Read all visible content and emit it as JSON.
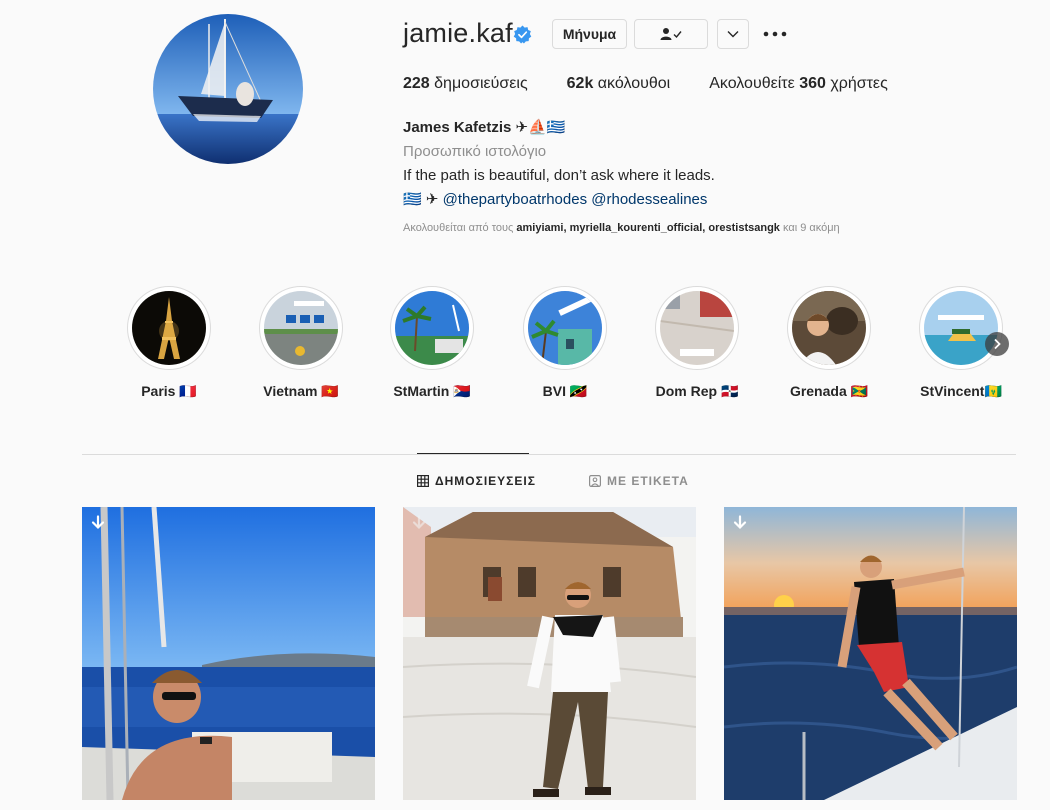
{
  "profile": {
    "username": "jamie.kaf",
    "verified": true,
    "buttons": {
      "message": "Μήνυμα"
    },
    "stats": [
      {
        "value": "228",
        "label": " δημοσιεύσεις"
      },
      {
        "value": "62k",
        "label": " ακόλουθοι"
      },
      {
        "prefix": "Ακολουθείτε ",
        "value": "360",
        "label": " χρήστες"
      }
    ],
    "bio": {
      "name": "James Kafetzis ✈⛵🇬🇷",
      "category": "Προσωπικό ιστολόγιο",
      "line1": "If the path is beautiful, don’t ask where it leads.",
      "line2_prefix": "🇬🇷 ✈ ",
      "mention1": "@thepartyboatrhodes",
      "mention2": "@rhodessealines"
    },
    "followed_by": {
      "prefix": "Ακολουθείται από τους ",
      "users": "amiyiami, myriella_kourenti_official, orestistsangk",
      "suffix": " και 9 ακόμη"
    }
  },
  "highlights": [
    {
      "label": "Paris 🇫🇷"
    },
    {
      "label": "Vietnam 🇻🇳"
    },
    {
      "label": "StMartin 🇸🇽"
    },
    {
      "label": "BVI 🇰🇳"
    },
    {
      "label": "Dom Rep 🇩🇴"
    },
    {
      "label": "Grenada 🇬🇩"
    },
    {
      "label": "StVincent🇻🇨"
    }
  ],
  "tabs": {
    "posts": "ΔΗΜΟΣΙΕΥΣΕΙΣ",
    "tagged": "ΜΕ ΕΤΙΚΕΤΑ"
  },
  "colors": {
    "verified": "#3897f0",
    "link": "#00376b",
    "muted": "#8e8e8e",
    "border": "#dbdbdb"
  }
}
